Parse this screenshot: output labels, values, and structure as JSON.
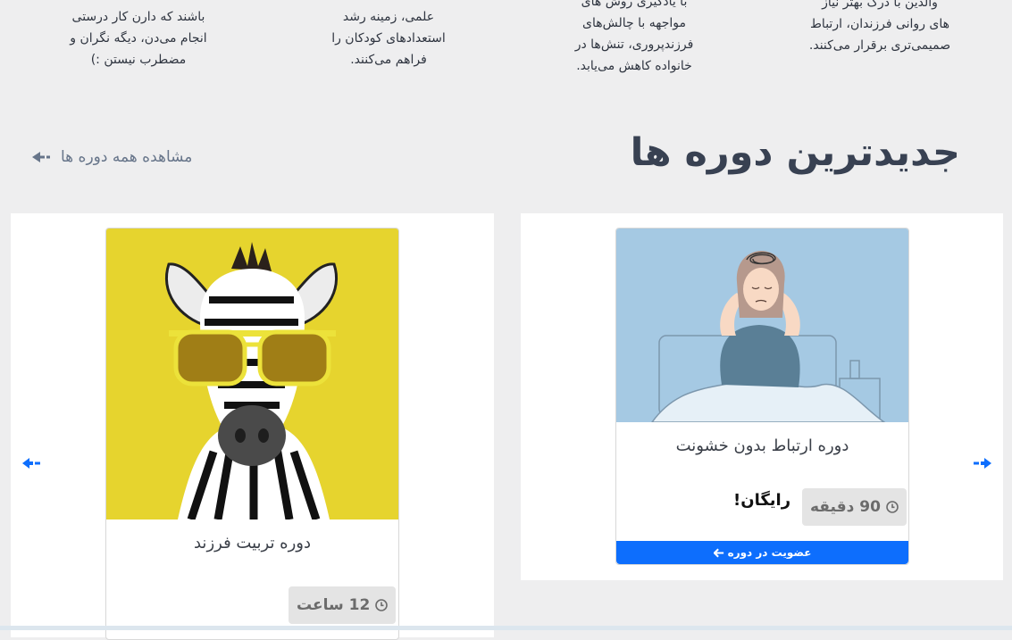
{
  "features": [
    {
      "lines": [
        "والدین با درک بهتر نیاز",
        "های روانی فرزندان، ارتباط",
        "صمیمی‌تری برقرار می‌کنند."
      ]
    },
    {
      "lines": [
        "با یادگیری روش های",
        "مواجهه با چالش‌های",
        "فرزندپروری، تنش‌ها در",
        "خانواده کاهش می‌یابد."
      ]
    },
    {
      "lines": [
        "علمی، زمینه رشد",
        "استعدادهای کودکان را",
        "فراهم می‌کنند."
      ]
    },
    {
      "lines": [
        "باشند که دارن کار درستی",
        "انجام می‌دن، دیگه نگران و",
        "مضطرب نیستن :)"
      ]
    }
  ],
  "section": {
    "title": "جدیدترین دوره ها",
    "view_all": "مشاهده همه دوره ها"
  },
  "courses": [
    {
      "title": "دوره ارتباط بدون خشونت",
      "duration": "90 دقیقه",
      "price": "رایگان!",
      "enroll": "عضویت در دوره"
    },
    {
      "title": "دوره تربیت فرزند",
      "duration": "12 ساعت"
    }
  ],
  "colors": {
    "accent": "#0d6efd",
    "background": "#eeeeef",
    "heading": "#384152"
  },
  "icons": {
    "view_all": "arrow-left-icon",
    "duration": "clock-icon",
    "enroll": "arrow-left-icon",
    "prev": "carousel-prev-icon",
    "next": "carousel-next-icon"
  }
}
